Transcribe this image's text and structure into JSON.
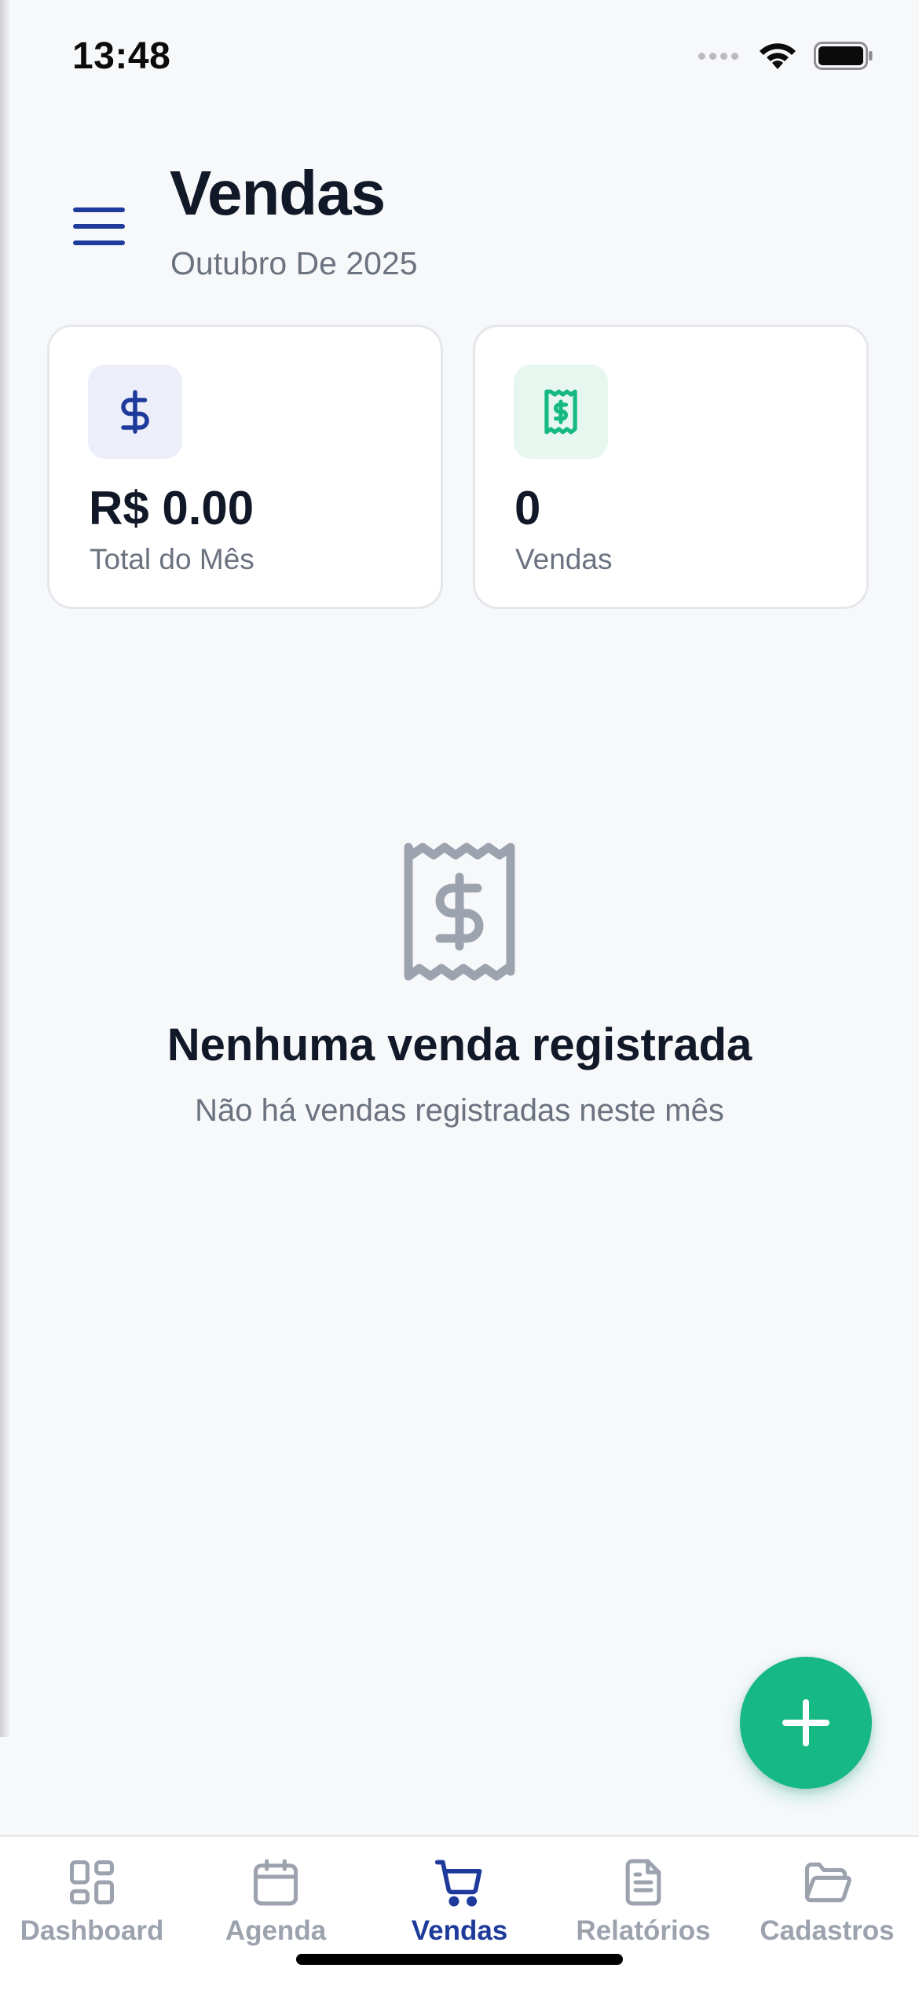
{
  "status_bar": {
    "time": "13:48"
  },
  "header": {
    "title": "Vendas",
    "subtitle": "Outubro De 2025"
  },
  "summary_cards": [
    {
      "value": "R$ 0.00",
      "label": "Total do Mês",
      "icon": "dollar-icon"
    },
    {
      "value": "0",
      "label": "Vendas",
      "icon": "receipt-icon"
    }
  ],
  "empty_state": {
    "icon": "receipt-icon",
    "title": "Nenhuma venda registrada",
    "description": "Não há vendas registradas neste mês"
  },
  "fab": {
    "icon": "plus-icon"
  },
  "tab_bar": {
    "active": "Vendas",
    "tabs": [
      {
        "label": "Dashboard",
        "icon": "dashboard-icon"
      },
      {
        "label": "Agenda",
        "icon": "calendar-icon"
      },
      {
        "label": "Vendas",
        "icon": "cart-icon"
      },
      {
        "label": "Relatórios",
        "icon": "document-icon"
      },
      {
        "label": "Cadastros",
        "icon": "folder-icon"
      }
    ]
  },
  "colors": {
    "primary": "#1e3a9a",
    "accent_green": "#16b884",
    "background": "#f7f8fa",
    "muted_text": "#6b7280",
    "inactive_tab": "#9ca3af"
  }
}
